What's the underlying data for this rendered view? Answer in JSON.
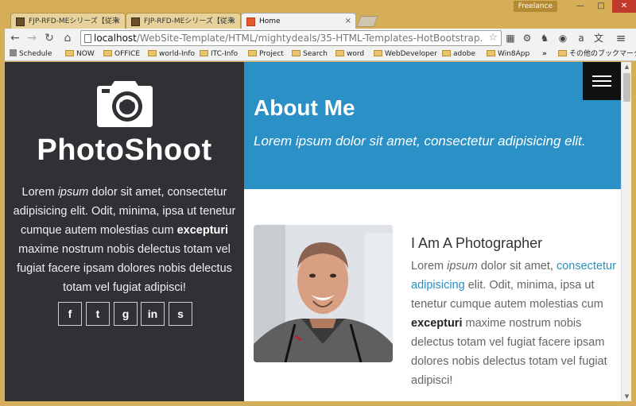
{
  "window": {
    "profile_label": "Freelance",
    "min_label": "—",
    "max_label": "□",
    "close_label": "✕"
  },
  "tabs": [
    {
      "label": "FJP-RFD-MEシリーズ【従来",
      "close": "×"
    },
    {
      "label": "FJP-RFD-MEシリーズ【従来",
      "close": "×"
    },
    {
      "label": "Home",
      "close": "×"
    }
  ],
  "toolbar": {
    "back": "←",
    "forward": "→",
    "reload": "↻",
    "home": "⌂",
    "url_host": "localhost",
    "url_path": "/WebSite-Template/HTML/mightydeals/35-HTML-Templates-HotBootstrap.",
    "star": "☆",
    "menu": "≡"
  },
  "bookmarks": [
    {
      "label": "Schedule",
      "icon": "apps-icon"
    },
    {
      "label": "NOW",
      "icon": "folder-icon"
    },
    {
      "label": "OFFICE",
      "icon": "folder-icon"
    },
    {
      "label": "world-Info",
      "icon": "folder-icon"
    },
    {
      "label": "ITC-Info",
      "icon": "folder-icon"
    },
    {
      "label": "Project",
      "icon": "folder-icon"
    },
    {
      "label": "Search",
      "icon": "folder-icon"
    },
    {
      "label": "word",
      "icon": "folder-icon"
    },
    {
      "label": "WebDeveloper",
      "icon": "folder-icon"
    },
    {
      "label": "adobe",
      "icon": "folder-icon"
    },
    {
      "label": "Win8App",
      "icon": "folder-icon"
    }
  ],
  "bookmarks_overflow": "»",
  "bookmarks_other": "その他のブックマーク",
  "sidebar": {
    "brand": "PhotoShoot",
    "intro_1": "Lorem ",
    "intro_em": "ipsum",
    "intro_2": " dolor sit amet, consectetur adipisicing elit. Odit, minima, ipsa ut tenetur cumque autem molestias cum ",
    "intro_bold": "excepturi",
    "intro_3": " maxime nostrum nobis delectus totam vel fugiat facere ipsam dolores nobis delectus totam vel fugiat adipisci!",
    "socials": [
      {
        "label": "f",
        "icon": "facebook-icon"
      },
      {
        "label": "t",
        "icon": "twitter-icon"
      },
      {
        "label": "g",
        "icon": "google-icon"
      },
      {
        "label": "in",
        "icon": "linkedin-icon"
      },
      {
        "label": "s",
        "icon": "skype-icon"
      }
    ]
  },
  "hero": {
    "title": "About Me",
    "tagline": "Lorem ipsum dolor sit amet, consectetur adipisicing elit."
  },
  "about": {
    "heading": "I Am A Photographer",
    "p1": "Lorem ",
    "p_em": "ipsum",
    "p2": " dolor sit amet, ",
    "p_link": "consectetur adipisicing",
    "p3": " elit. Odit, minima, ipsa ut tenetur cumque autem molestias cum ",
    "p_bold": "excepturi",
    "p4": " maxime nostrum nobis delectus totam vel fugiat facere ipsam dolores nobis delectus totam vel fugiat adipisci!"
  },
  "colors": {
    "sidebar_bg": "#2f3135",
    "hero_bg": "#2a90c5",
    "link": "#2a90c5"
  }
}
